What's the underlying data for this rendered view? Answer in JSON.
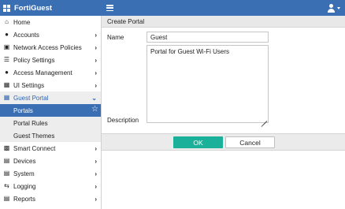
{
  "app": {
    "title": "FortiGuest"
  },
  "sidebar": {
    "items": [
      {
        "label": "Home",
        "icon": "home-icon"
      },
      {
        "label": "Accounts",
        "icon": "user-icon"
      },
      {
        "label": "Network Access Policies",
        "icon": "network-icon"
      },
      {
        "label": "Policy Settings",
        "icon": "sliders-icon"
      },
      {
        "label": "Access Management",
        "icon": "access-icon"
      },
      {
        "label": "UI Settings",
        "icon": "ui-settings-icon"
      },
      {
        "label": "Guest Portal",
        "icon": "portal-icon"
      },
      {
        "label": "Smart Connect",
        "icon": "smart-connect-icon"
      },
      {
        "label": "Devices",
        "icon": "devices-icon"
      },
      {
        "label": "System",
        "icon": "system-icon"
      },
      {
        "label": "Logging",
        "icon": "logging-icon"
      },
      {
        "label": "Reports",
        "icon": "reports-icon"
      }
    ],
    "submenu": [
      {
        "label": "Portals"
      },
      {
        "label": "Portal Rules"
      },
      {
        "label": "Guest Themes"
      }
    ]
  },
  "content": {
    "header": "Create Portal",
    "name_label": "Name",
    "name_value": "Guest",
    "description_label": "Description",
    "description_value": "Portal for Guest Wi-Fi Users",
    "ok_label": "OK",
    "cancel_label": "Cancel"
  }
}
